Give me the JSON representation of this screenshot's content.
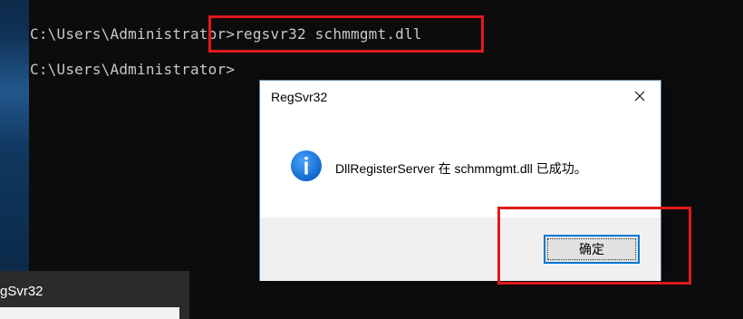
{
  "console": {
    "line1_prompt": "C:\\Users\\Administrator>",
    "line1_command": "regsvr32 schmmgmt.dll",
    "line2_prompt": "C:\\Users\\Administrator>"
  },
  "dialog": {
    "title": "RegSvr32",
    "message": "DllRegisterServer 在 schmmgmt.dll 已成功。",
    "ok_label": "确定",
    "icon": "info-icon",
    "close_icon": "close-icon"
  },
  "taskbar_preview": {
    "title": "gSvr32"
  },
  "colors": {
    "highlight": "#e0191b",
    "console_bg": "#0c0c0c",
    "console_text": "#c8c8c8",
    "accent": "#0078d7"
  }
}
